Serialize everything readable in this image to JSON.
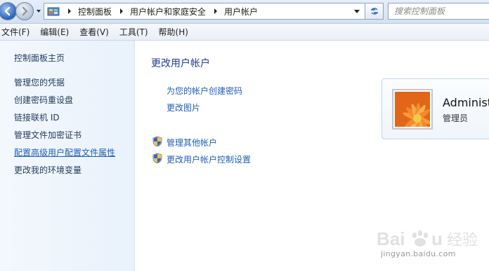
{
  "addressbar": {
    "breadcrumb": [
      "控制面板",
      "用户帐户和家庭安全",
      "用户帐户"
    ],
    "search_placeholder": "搜索控制面板"
  },
  "menubar": {
    "items": [
      "文件(F)",
      "编辑(E)",
      "查看(V)",
      "工具(T)",
      "帮助(H)"
    ]
  },
  "sidebar": {
    "items": [
      {
        "label": "控制面板主页"
      },
      {
        "label": "管理您的凭据"
      },
      {
        "label": "创建密码重设盘"
      },
      {
        "label": "链接联机 ID"
      },
      {
        "label": "管理文件加密证书"
      },
      {
        "label": "配置高级用户配置文件属性"
      },
      {
        "label": "更改我的环境变量"
      }
    ]
  },
  "main": {
    "title": "更改用户帐户",
    "tasks": [
      {
        "label": "为您的帐户创建密码"
      },
      {
        "label": "更改图片"
      }
    ],
    "shield_tasks": [
      {
        "label": "管理其他帐户"
      },
      {
        "label": "更改用户帐户控制设置"
      }
    ]
  },
  "account": {
    "name": "Administ",
    "role": "管理员"
  },
  "watermark": {
    "logo": "Baidu 经验",
    "url": "jingyan.baidu.com"
  },
  "colors": {
    "link": "#1e5fb8",
    "title": "#1e3f8a",
    "sidebar_bg": "#eef4fb"
  }
}
